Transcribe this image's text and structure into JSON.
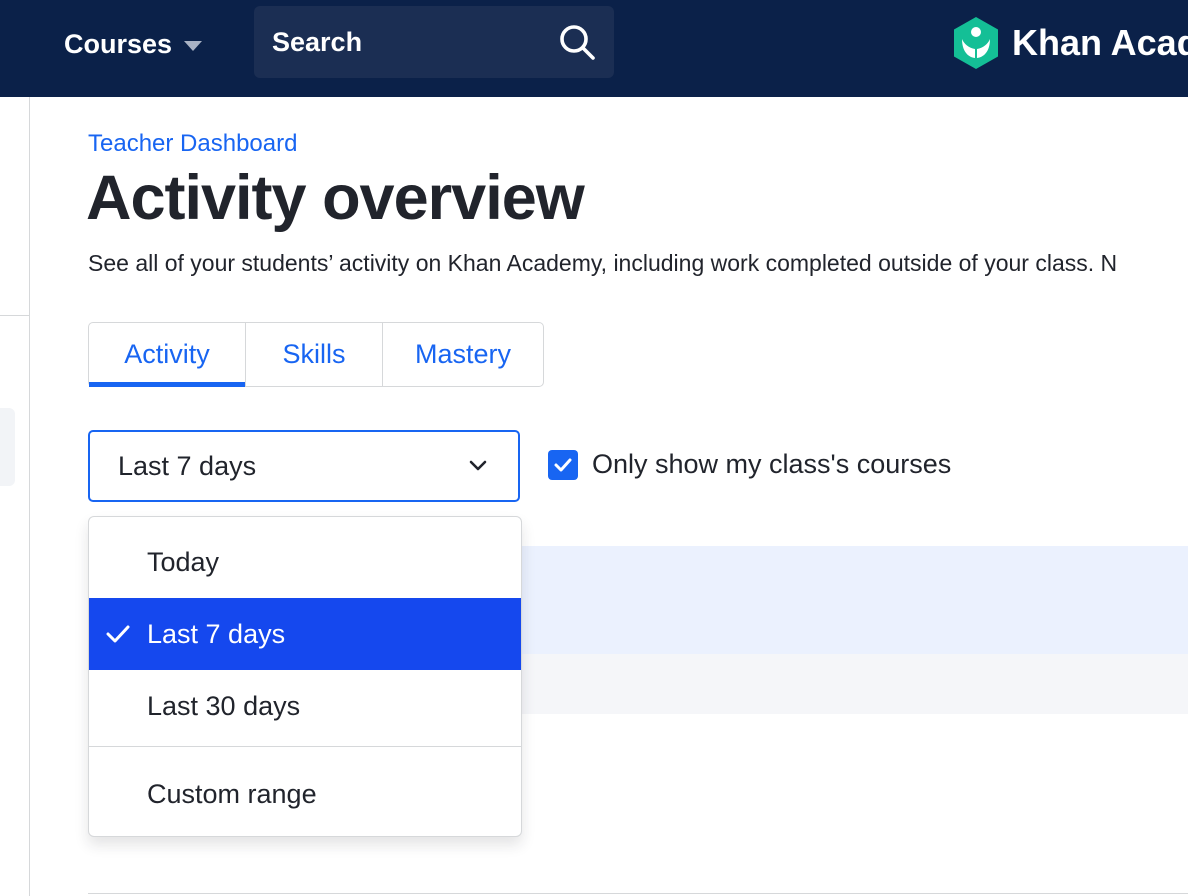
{
  "nav": {
    "courses_label": "Courses",
    "search_placeholder": "Search",
    "logo_text": "Khan Acad"
  },
  "header": {
    "breadcrumb": "Teacher Dashboard",
    "title": "Activity overview",
    "description": "See all of your students’ activity on Khan Academy, including work completed outside of your class. N"
  },
  "tabs": [
    {
      "label": "Activity",
      "active": true
    },
    {
      "label": "Skills",
      "active": false
    },
    {
      "label": "Mastery",
      "active": false
    }
  ],
  "filters": {
    "date_range_value": "Last 7 days",
    "only_class_courses_label": "Only show my class's courses",
    "only_class_courses_checked": true
  },
  "dropdown": {
    "options": [
      {
        "label": "Today",
        "selected": false
      },
      {
        "label": "Last 7 days",
        "selected": true
      },
      {
        "label": "Last 30 days",
        "selected": false
      }
    ],
    "custom_label": "Custom range"
  },
  "colors": {
    "nav_bg": "#0b2149",
    "accent": "#1865f2",
    "selected_bg": "#1548ee",
    "logo_green": "#14bf96"
  }
}
